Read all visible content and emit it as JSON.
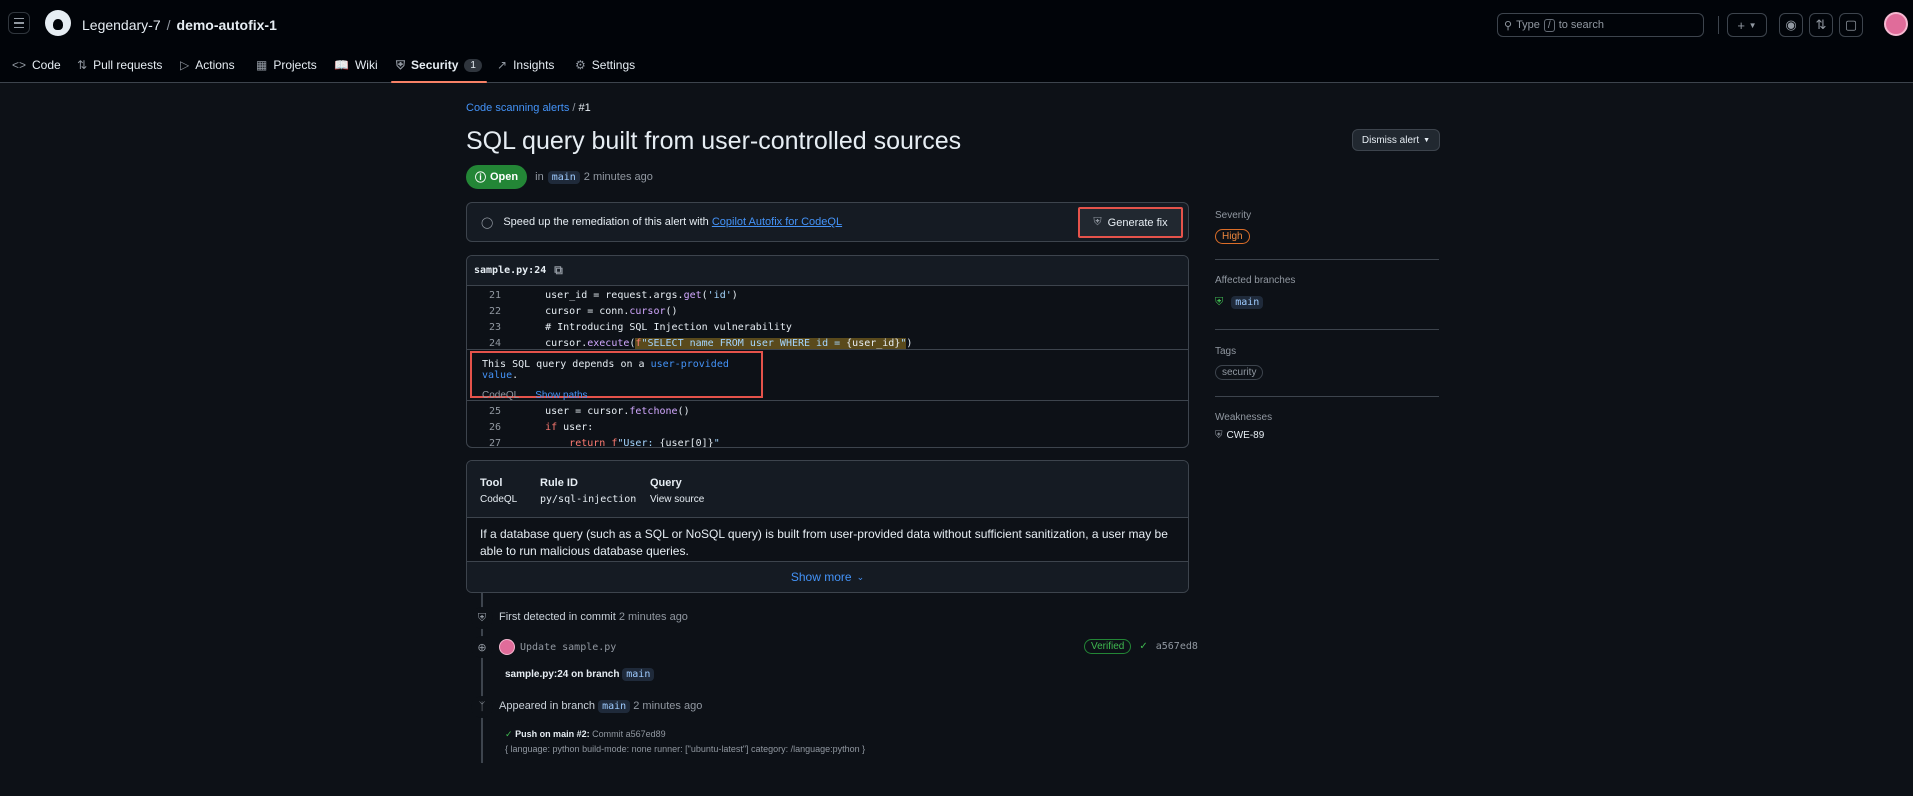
{
  "header": {
    "owner": "Legendary-7",
    "separator": "/",
    "repo": "demo-autofix-1",
    "search_prefix": "Type",
    "search_key": "/",
    "search_suffix": "to search"
  },
  "nav": {
    "items": [
      {
        "label": "Code",
        "icon": "code-icon"
      },
      {
        "label": "Pull requests",
        "icon": "pull-request-icon"
      },
      {
        "label": "Actions",
        "icon": "play-icon"
      },
      {
        "label": "Projects",
        "icon": "table-icon"
      },
      {
        "label": "Wiki",
        "icon": "book-icon"
      },
      {
        "label": "Security",
        "icon": "shield-icon",
        "count": "1"
      },
      {
        "label": "Insights",
        "icon": "graph-icon"
      },
      {
        "label": "Settings",
        "icon": "gear-icon"
      }
    ]
  },
  "breadcrumb": {
    "parent": "Code scanning alerts",
    "sep": "/",
    "current": "#1"
  },
  "alert": {
    "title": "SQL query built from user-controlled sources",
    "dismiss_label": "Dismiss alert",
    "status": "Open",
    "in_label": "in",
    "branch": "main",
    "time": "2 minutes ago"
  },
  "autofix": {
    "text": "Speed up the remediation of this alert with",
    "link": "Copilot Autofix for CodeQL",
    "button": "Generate fix"
  },
  "code": {
    "file": "sample.py:24",
    "lines_before": [
      {
        "n": "21",
        "text": "    user_id = request.args.get('id')"
      },
      {
        "n": "22",
        "text": "    cursor = conn.cursor()"
      },
      {
        "n": "23",
        "text": "    # Introducing SQL Injection vulnerability"
      },
      {
        "n": "24",
        "text": "    cursor.execute(f\"SELECT name FROM user WHERE id = {user_id}\")"
      }
    ],
    "alert_msg_prefix": "This SQL query depends on a",
    "alert_msg_link": "user-provided value",
    "alert_msg_suffix": ".",
    "alert_tool": "CodeQL",
    "alert_paths": "Show paths",
    "lines_after": [
      {
        "n": "25",
        "text": "    user = cursor.fetchone()"
      },
      {
        "n": "26",
        "text": "    if user:"
      },
      {
        "n": "27",
        "text": "        return f\"User: {user[0]}\""
      }
    ]
  },
  "info": {
    "tool_h": "Tool",
    "tool_v": "CodeQL",
    "rule_h": "Rule ID",
    "rule_v": "py/sql-injection",
    "query_h": "Query",
    "query_v": "View source",
    "description": "If a database query (such as a SQL or NoSQL query) is built from user-provided data without sufficient sanitization, a user may be able to run malicious database queries.",
    "show_more": "Show more"
  },
  "timeline": {
    "first_detected": "First detected in commit",
    "first_time": "2 minutes ago",
    "commit_msg": "Update sample.py",
    "verified": "Verified",
    "sha": "a567ed8",
    "location": "sample.py:24 on branch",
    "location_branch": "main",
    "appeared": "Appeared in branch",
    "appeared_branch": "main",
    "appeared_time": "2 minutes ago",
    "push_title": "Push on main #2:",
    "push_commit": "Commit a567ed89",
    "push_config": "{ language: python build-mode: none runner: [\"ubuntu-latest\"] category: /language:python }"
  },
  "sidebar": {
    "severity_h": "Severity",
    "severity_v": "High",
    "branches_h": "Affected branches",
    "branch_v": "main",
    "tags_h": "Tags",
    "tag_v": "security",
    "weak_h": "Weaknesses",
    "weak_v": "CWE-89"
  }
}
